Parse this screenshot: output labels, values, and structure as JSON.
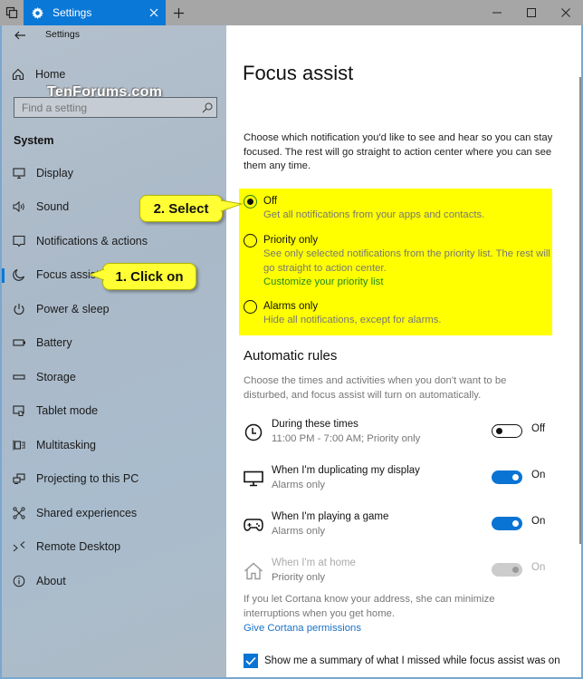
{
  "window": {
    "tab_title": "Settings",
    "icons": {
      "apps": "task-view-icon",
      "tab": "gear-icon",
      "tab_close": "close-icon",
      "new_tab": "plus-icon",
      "minimize": "minimize-icon",
      "maximize": "maximize-icon",
      "close": "close-icon"
    }
  },
  "sidebar": {
    "app_title": "Settings",
    "home_label": "Home",
    "watermark": "TenForums.com",
    "search": {
      "placeholder": "Find a setting",
      "value": ""
    },
    "section_title": "System",
    "items": [
      {
        "label": "Display",
        "icon": "monitor-icon",
        "active": false
      },
      {
        "label": "Sound",
        "icon": "speaker-icon",
        "active": false
      },
      {
        "label": "Notifications & actions",
        "icon": "notification-icon",
        "active": false
      },
      {
        "label": "Focus assist",
        "icon": "moon-icon",
        "active": true
      },
      {
        "label": "Power & sleep",
        "icon": "power-icon",
        "active": false
      },
      {
        "label": "Battery",
        "icon": "battery-icon",
        "active": false
      },
      {
        "label": "Storage",
        "icon": "storage-icon",
        "active": false
      },
      {
        "label": "Tablet mode",
        "icon": "tablet-mode-icon",
        "active": false
      },
      {
        "label": "Multitasking",
        "icon": "multitasking-icon",
        "active": false
      },
      {
        "label": "Projecting to this PC",
        "icon": "projecting-icon",
        "active": false
      },
      {
        "label": "Shared experiences",
        "icon": "shared-experiences-icon",
        "active": false
      },
      {
        "label": "Remote Desktop",
        "icon": "remote-desktop-icon",
        "active": false
      },
      {
        "label": "About",
        "icon": "info-icon",
        "active": false
      }
    ]
  },
  "main": {
    "title": "Focus assist",
    "intro": "Choose which notification you'd like to see and hear so you can stay focused. The rest will go straight to action center where you can see them any time.",
    "options": [
      {
        "label": "Off",
        "description": "Get all notifications from your apps and contacts.",
        "selected": true
      },
      {
        "label": "Priority only",
        "description": "See only selected notifications from the priority list. The rest will go straight to action center.",
        "link": "Customize your priority list",
        "selected": false
      },
      {
        "label": "Alarms only",
        "description": "Hide all notifications, except for alarms.",
        "selected": false
      }
    ],
    "automatic_rules": {
      "title": "Automatic rules",
      "description": "Choose the times and activities when you don't want to be disturbed, and focus assist will turn on automatically.",
      "rules": [
        {
          "title": "During these times",
          "subtitle": "11:00 PM - 7:00 AM; Priority only",
          "state": "Off",
          "on": false,
          "enabled": true,
          "icon": "clock-icon"
        },
        {
          "title": "When I'm duplicating my display",
          "subtitle": "Alarms only",
          "state": "On",
          "on": true,
          "enabled": true,
          "icon": "monitor-icon"
        },
        {
          "title": "When I'm playing a game",
          "subtitle": "Alarms only",
          "state": "On",
          "on": true,
          "enabled": true,
          "icon": "gamepad-icon"
        },
        {
          "title": "When I'm at home",
          "subtitle": "Priority only",
          "state": "On",
          "on": true,
          "enabled": false,
          "icon": "home-icon"
        }
      ]
    },
    "cortana_description": "If you let Cortana know your address, she can minimize interruptions when you get home.",
    "cortana_link": "Give Cortana permissions",
    "summary_checkbox": {
      "label": "Show me a summary of what I missed while focus assist was on",
      "checked": true
    }
  },
  "annotations": {
    "callout_1": "1. Click on",
    "callout_2": "2. Select",
    "highlight_color": "#ffff00",
    "callout_color": "#ffff33"
  },
  "colors": {
    "accent": "#0a78d7",
    "link_green": "#1e8a1e",
    "link_blue": "#1a72c8"
  }
}
